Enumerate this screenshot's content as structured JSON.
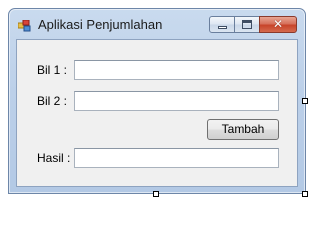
{
  "window": {
    "title": "Aplikasi Penjumlahan",
    "icon": "windows-form-icon",
    "controls": {
      "minimize_icon": "minimize-icon",
      "maximize_icon": "maximize-icon",
      "close_icon": "close-icon",
      "close_glyph": "✕"
    }
  },
  "form": {
    "bil1": {
      "label": "Bil 1 :",
      "value": ""
    },
    "bil2": {
      "label": "Bil 2 :",
      "value": ""
    },
    "tambah_button": "Tambah",
    "hasil": {
      "label": "Hasil :",
      "value": ""
    }
  },
  "colors": {
    "frame": "#bcd0e9",
    "client": "#f0f0f0",
    "close": "#c8442a"
  }
}
